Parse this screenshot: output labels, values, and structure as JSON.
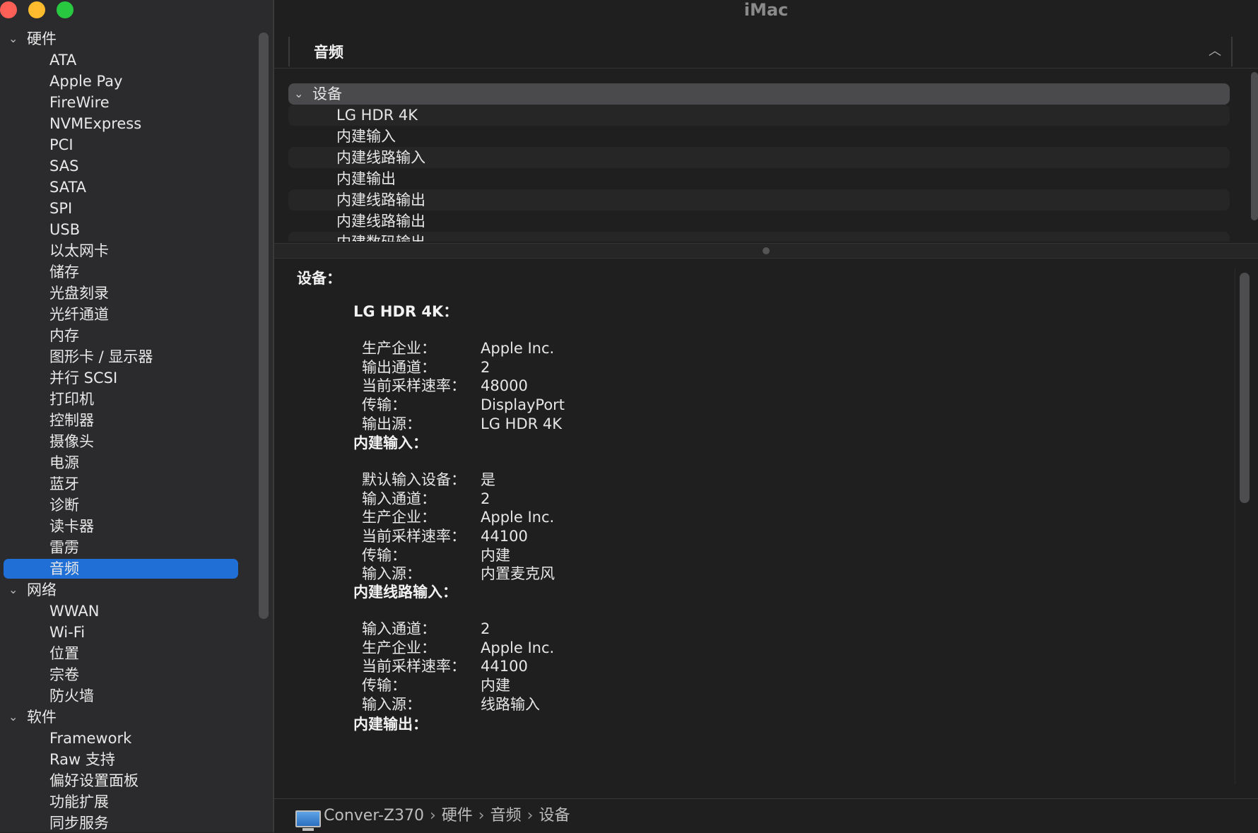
{
  "window": {
    "title": "iMac"
  },
  "sidebar": {
    "groups": [
      {
        "label": "硬件",
        "items": [
          "ATA",
          "Apple Pay",
          "FireWire",
          "NVMExpress",
          "PCI",
          "SAS",
          "SATA",
          "SPI",
          "USB",
          "以太网卡",
          "储存",
          "光盘刻录",
          "光纤通道",
          "内存",
          "图形卡 / 显示器",
          "并行 SCSI",
          "打印机",
          "控制器",
          "摄像头",
          "电源",
          "蓝牙",
          "诊断",
          "读卡器",
          "雷雳",
          "音频"
        ]
      },
      {
        "label": "网络",
        "items": [
          "WWAN",
          "Wi-Fi",
          "位置",
          "宗卷",
          "防火墙"
        ]
      },
      {
        "label": "软件",
        "items": [
          "Framework",
          "Raw 支持",
          "偏好设置面板",
          "功能扩展",
          "同步服务"
        ]
      }
    ],
    "selected": "音频"
  },
  "section": {
    "title": "音频",
    "collapse_icon": "chevron-up-icon"
  },
  "device_list": {
    "group_label": "设备",
    "items": [
      "LG HDR 4K",
      "内建输入",
      "内建线路输入",
      "内建输出",
      "内建线路输出",
      "内建线路输出",
      "内建数码输出"
    ]
  },
  "detail": {
    "heading": "设备：",
    "devices": [
      {
        "title": "LG HDR 4K：",
        "props": [
          {
            "k": "生产企业：",
            "v": "Apple Inc."
          },
          {
            "k": "输出通道：",
            "v": "2"
          },
          {
            "k": "当前采样速率：",
            "v": "48000"
          },
          {
            "k": "传输：",
            "v": "DisplayPort"
          },
          {
            "k": "输出源：",
            "v": "LG HDR 4K"
          }
        ]
      },
      {
        "title": "内建输入：",
        "props": [
          {
            "k": "默认输入设备：",
            "v": "是"
          },
          {
            "k": "输入通道：",
            "v": "2"
          },
          {
            "k": "生产企业：",
            "v": "Apple Inc."
          },
          {
            "k": "当前采样速率：",
            "v": "44100"
          },
          {
            "k": "传输：",
            "v": "内建"
          },
          {
            "k": "输入源：",
            "v": "内置麦克风"
          }
        ]
      },
      {
        "title": "内建线路输入：",
        "props": [
          {
            "k": "输入通道：",
            "v": "2"
          },
          {
            "k": "生产企业：",
            "v": "Apple Inc."
          },
          {
            "k": "当前采样速率：",
            "v": "44100"
          },
          {
            "k": "传输：",
            "v": "内建"
          },
          {
            "k": "输入源：",
            "v": "线路输入"
          }
        ]
      },
      {
        "title": "内建输出：",
        "props": []
      }
    ]
  },
  "pathbar": {
    "crumbs": [
      "Conver-Z370",
      "硬件",
      "音频",
      "设备"
    ],
    "separator": "›"
  }
}
